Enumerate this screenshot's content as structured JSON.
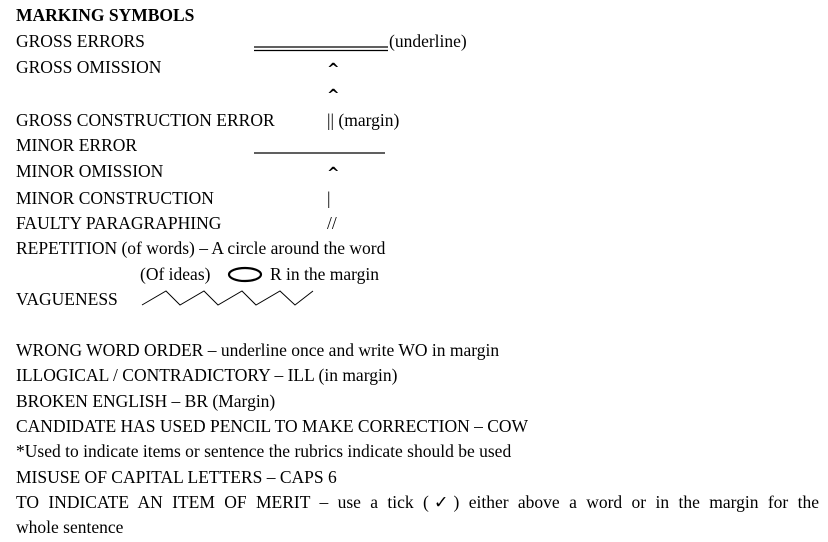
{
  "document": {
    "title": "MARKING SYMBOLS",
    "rows": [
      {
        "label": "GROSS ERRORS",
        "symbol": "double-underline",
        "note": "(underline)"
      },
      {
        "label": "GROSS OMISSION",
        "symbol": "^"
      },
      {
        "label": "",
        "symbol": "^"
      },
      {
        "label": "GROSS CONSTRUCTION ERROR",
        "symbol": "||",
        "note": "(margin)"
      },
      {
        "label": "MINOR ERROR",
        "symbol": "single-underline"
      },
      {
        "label": "MINOR OMISSION",
        "symbol": "^"
      },
      {
        "label": "MINOR CONSTRUCTION",
        "symbol": "|"
      },
      {
        "label": "FAULTY PARAGRAPHING",
        "symbol": "//"
      }
    ],
    "repetition": {
      "words_line": "REPETITION (of words) – A circle around the word",
      "ideas_label": "(Of ideas)",
      "ideas_symbol": "ellipse",
      "ideas_note": "R in the margin"
    },
    "vagueness": {
      "label": "VAGUENESS",
      "symbol": "zigzag"
    },
    "rules": [
      "WRONG WORD ORDER – underline once and write WO in margin",
      "ILLOGICAL / CONTRADICTORY – ILL (in margin)",
      "BROKEN ENGLISH – BR (Margin)",
      "CANDIDATE HAS USED PENCIL TO MAKE CORRECTION – COW",
      "*Used to indicate items or sentence the rubrics indicate should be used",
      "MISUSE OF CAPITAL LETTERS – CAPS 6"
    ],
    "merit": {
      "line1": "TO INDICATE AN ITEM OF MERIT – use a tick (✓) either above a word or in the margin for the",
      "line2": "whole sentence"
    }
  }
}
